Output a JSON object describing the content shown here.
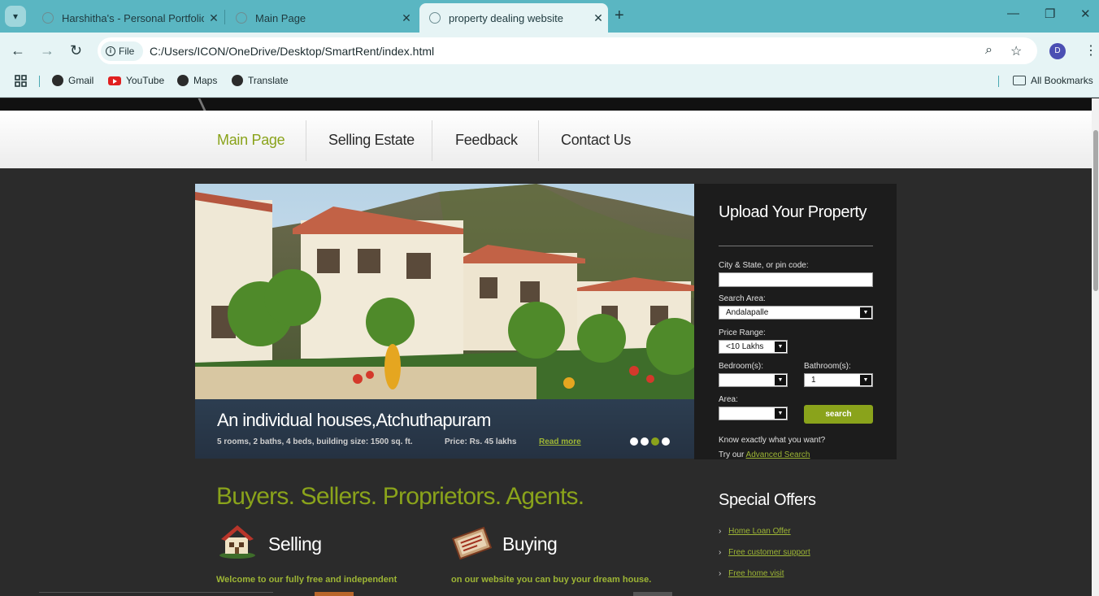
{
  "browser": {
    "tabs": [
      {
        "title": "Harshitha's - Personal Portfolio",
        "active": false
      },
      {
        "title": "Main Page",
        "active": false
      },
      {
        "title": "property dealing website",
        "active": true
      }
    ],
    "new_tab": "+",
    "window_controls": {
      "minimize": "—",
      "restore": "❐",
      "close": "✕"
    },
    "nav": {
      "back": "←",
      "forward": "→",
      "reload": "↻"
    },
    "address": {
      "chip": "File",
      "url": "C:/Users/ICON/OneDrive/Desktop/SmartRent/index.html"
    },
    "profile_initial": "D",
    "bookmarks": [
      {
        "label": "Gmail"
      },
      {
        "label": "YouTube"
      },
      {
        "label": "Maps"
      },
      {
        "label": "Translate"
      }
    ],
    "all_bookmarks": "All Bookmarks"
  },
  "site": {
    "nav": [
      {
        "label": "Main Page",
        "active": true
      },
      {
        "label": "Selling Estate",
        "active": false
      },
      {
        "label": "Feedback",
        "active": false
      },
      {
        "label": "Contact Us",
        "active": false
      }
    ],
    "slide": {
      "title": "An individual houses,Atchuthapuram",
      "description": "5 rooms, 2 baths, 4 beds, building size: 1500 sq. ft.",
      "price": "Price: Rs. 45 lakhs",
      "read_more": "Read more",
      "active_dot": 3,
      "dot_count": 4
    },
    "upload": {
      "title": "Upload Your Property",
      "city_label": "City & State, or pin code:",
      "city_value": "",
      "area_search_label": "Search Area:",
      "area_search_value": "Andalapalle",
      "price_label": "Price Range:",
      "price_value": "<10 Lakhs",
      "bedroom_label": "Bedroom(s):",
      "bedroom_value": "",
      "bathroom_label": "Bathroom(s):",
      "bathroom_value": "1",
      "area_label": "Area:",
      "area_value": "",
      "search_button": "search",
      "know_text": "Know exactly what you want?",
      "try_text": "Try our",
      "advanced_link": "Advanced Search"
    },
    "headline": "Buyers. Sellers. Proprietors. Agents.",
    "features": [
      {
        "title": "Selling",
        "text": "Welcome to our fully free and independent"
      },
      {
        "title": "Buying",
        "text": "on our website you can buy your dream house."
      }
    ],
    "offers": {
      "title": "Special Offers",
      "items": [
        "Home Loan Offer",
        "Free customer support",
        "Free home visit"
      ]
    }
  },
  "colors": {
    "accent": "#8aa31b",
    "tab_bar": "#5ab6c2",
    "toolbar": "#e6f4f5",
    "page_bg": "#2b2b2b"
  }
}
